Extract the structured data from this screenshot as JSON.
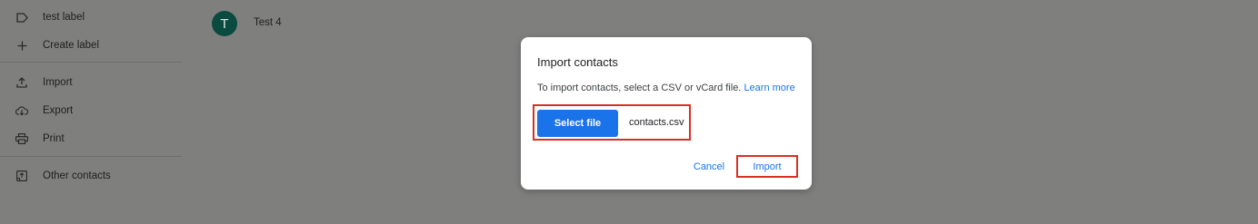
{
  "sidebar": {
    "items": [
      {
        "label": "test label",
        "icon": "label-icon"
      },
      {
        "label": "Create label",
        "icon": "plus-icon"
      },
      {
        "label": "Import",
        "icon": "upload-icon"
      },
      {
        "label": "Export",
        "icon": "cloud-download-icon"
      },
      {
        "label": "Print",
        "icon": "print-icon"
      },
      {
        "label": "Other contacts",
        "icon": "other-contacts-icon"
      }
    ]
  },
  "contacts": [
    {
      "initial": "T",
      "name": "Test 4",
      "avatar_color": "#0b4a3e"
    }
  ],
  "dialog": {
    "title": "Import contacts",
    "description": "To import contacts, select a CSV or vCard file.",
    "learn_more": "Learn more",
    "select_file_label": "Select file",
    "file_name": "contacts.csv",
    "cancel_label": "Cancel",
    "import_label": "Import"
  },
  "colors": {
    "accent": "#1a73e8",
    "highlight": "#d93025",
    "overlay": "#7f7f7e"
  }
}
